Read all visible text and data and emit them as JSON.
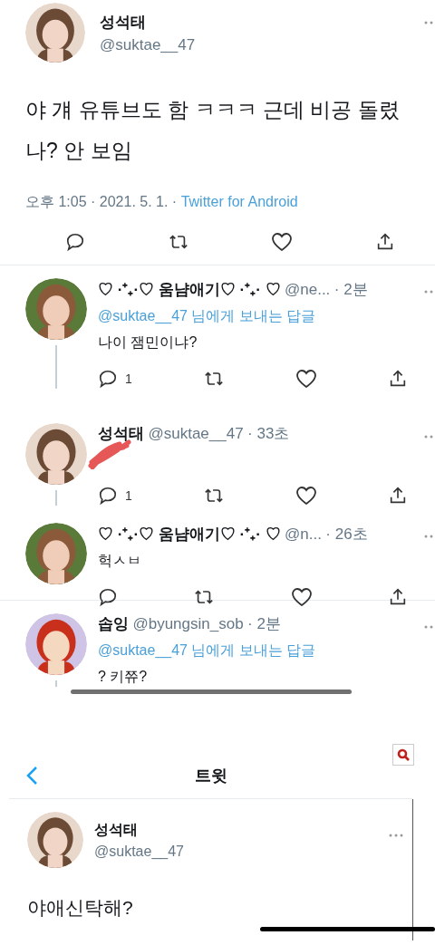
{
  "main_tweet": {
    "name": "성석태",
    "handle": "@suktae__47",
    "text": "야 걔 유튜브도 함 ㅋㅋㅋ 근데 비공 돌렸나? 안 보임",
    "time": "오후 1:05 · 2021. 5. 1. ·",
    "source": "Twitter for Android"
  },
  "replies": [
    {
      "name": "♡ ·⁺₊·♡ 움냠애기♡ ·⁺₊· ♡",
      "handle": "@ne...",
      "time": "· 2분",
      "reply_to_handle": "@suktae__47",
      "reply_to_text": "님에게 보내는 답글",
      "text": "나이 잼민이냐?",
      "reply_count": "1",
      "thread_continues": true,
      "redacted": false,
      "struck": false,
      "actions_shown": true
    },
    {
      "name": "성석태",
      "handle": "@suktae__47",
      "time": "· 33초",
      "redacted": true,
      "struck": false,
      "reply_count": "1",
      "thread_continues": true,
      "actions_shown": true
    },
    {
      "name": "♡ ·⁺₊·♡ 움냠애기♡ ·⁺₊· ♡",
      "handle": "@n...",
      "time": "· 26초",
      "text": "헉ㅅㅂ",
      "thread_continues": false,
      "redacted": false,
      "struck": false,
      "actions_shown": true
    },
    {
      "name": "솝잉",
      "handle": "@byungsin_sob",
      "time": "· 2분",
      "reply_to_handle": "@suktae__47",
      "reply_to_text": "님에게 보내는 답글",
      "text": "? 키쮸?",
      "thread_continues": true,
      "redacted": false,
      "struck": true,
      "actions_shown": false
    }
  ],
  "second_screen": {
    "header": {
      "title": "트윗"
    },
    "tweet": {
      "name": "성석태",
      "handle": "@suktae__47",
      "text": "야애신탁해?"
    }
  }
}
